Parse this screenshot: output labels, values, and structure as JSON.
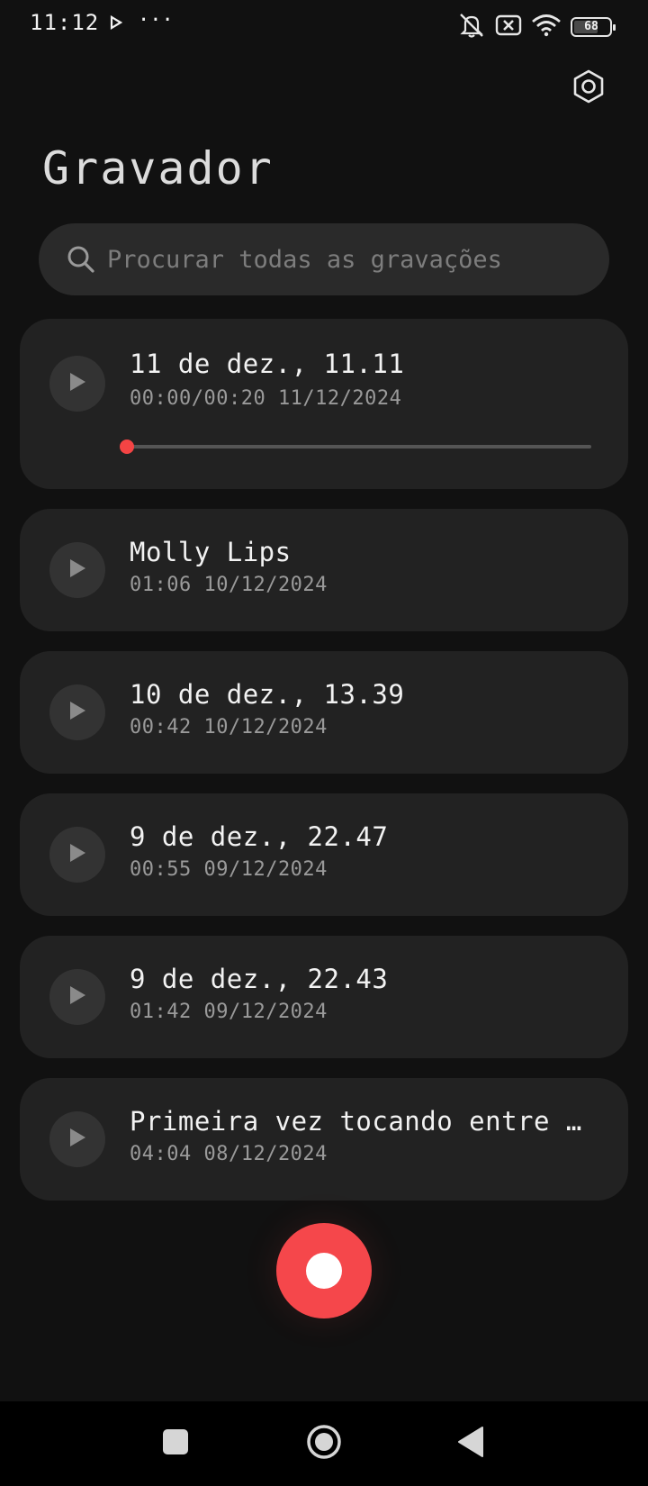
{
  "status_bar": {
    "time": "11:12",
    "more": "···",
    "battery_level": "68",
    "icons": [
      "play-icon",
      "mute-icon",
      "sim-off-icon",
      "wifi-icon",
      "battery-icon"
    ]
  },
  "header": {
    "title": "Gravador",
    "settings_icon": "gear-hexagon-icon"
  },
  "search": {
    "placeholder": "Procurar todas as gravações"
  },
  "recordings": [
    {
      "title": "11 de dez., 11.11",
      "meta": "00:00/00:20  11/12/2024",
      "playing": true,
      "progress": 0
    },
    {
      "title": "Molly Lips",
      "meta": "01:06  10/12/2024"
    },
    {
      "title": "10 de dez., 13.39",
      "meta": "00:42  10/12/2024"
    },
    {
      "title": "9 de dez., 22.47",
      "meta": "00:55  09/12/2024"
    },
    {
      "title": "9 de dez., 22.43",
      "meta": "01:42  09/12/2024"
    },
    {
      "title": "Primeira vez tocando entre a...",
      "meta": "04:04  08/12/2024"
    }
  ],
  "colors": {
    "background": "#111111",
    "card": "#222222",
    "accent_red": "#f5474b",
    "text_primary": "#f2f2f2",
    "text_secondary": "#9a9a9a"
  },
  "nav": {
    "icons": [
      "square-icon",
      "home-circle-icon",
      "back-triangle-icon"
    ]
  }
}
